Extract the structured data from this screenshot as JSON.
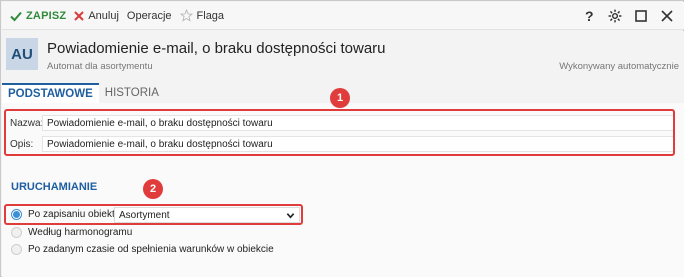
{
  "toolbar": {
    "save_label": "ZAPISZ",
    "cancel_label": "Anuluj",
    "operations_label": "Operacje",
    "flag_label": "Flaga"
  },
  "header": {
    "avatar": "AU",
    "title": "Powiadomienie e-mail, o braku dostępności towaru",
    "subtitle": "Automat dla asortymentu",
    "execution": "Wykonywany automatycznie"
  },
  "tabs": [
    {
      "label": "PODSTAWOWE",
      "active": true
    },
    {
      "label": "HISTORIA",
      "active": false
    }
  ],
  "fields": {
    "name_label": "Nazwa:",
    "name_value": "Powiadomienie e-mail, o braku dostępności towaru",
    "description_label": "Opis:",
    "description_value": "Powiadomienie e-mail, o braku dostępności towaru"
  },
  "trigger": {
    "section_title": "URUCHAMIANIE",
    "options": [
      {
        "label": "Po zapisaniu obiektu",
        "checked": true
      },
      {
        "label": "Według harmonogramu",
        "checked": false
      },
      {
        "label": "Po zadanym czasie od spełnienia warunków w obiekcie",
        "checked": false
      }
    ],
    "object_select_value": "Asortyment"
  },
  "annotations": [
    "1",
    "2"
  ],
  "colors": {
    "accent": "#1f5fa0",
    "save_green": "#2f8a3a",
    "cancel_red": "#d93a3a",
    "annotation_red": "#e03c3c",
    "radio_blue": "#3a8fd6"
  }
}
